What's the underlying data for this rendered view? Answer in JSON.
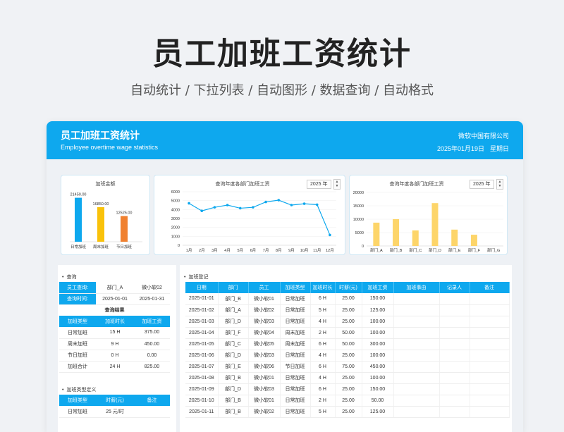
{
  "hero": {
    "title": "员工加班工资统计",
    "subtitle": "自动统计 / 下拉列表 / 自动图形 / 数据查询 / 自动格式"
  },
  "header": {
    "title": "员工加班工资统计",
    "subtitle": "Employee overtime wage statistics",
    "company": "微软中国有限公司",
    "date": "2025年01月19日",
    "weekday": "星期日"
  },
  "colors": {
    "accent": "#0ea8ee",
    "bar_weekday": "#0ea8ee",
    "bar_weekend": "#f9c20a",
    "bar_holiday": "#f0802f",
    "dept_bar": "#fdd56a"
  },
  "chart_data": [
    {
      "type": "bar",
      "title": "加班金额",
      "categories": [
        "日常加班",
        "周末加班",
        "节日加班"
      ],
      "values": [
        21450.0,
        16850.0,
        12525.0
      ],
      "data_labels": [
        "21450.00",
        "16850.00",
        "12525.00"
      ]
    },
    {
      "type": "line",
      "title": "查询年度各部门加班工资",
      "year": "2025 年",
      "categories": [
        "1月",
        "2月",
        "3月",
        "4月",
        "5月",
        "6月",
        "7月",
        "8月",
        "9月",
        "10月",
        "11月",
        "12月"
      ],
      "values": [
        4700,
        3850,
        4250,
        4500,
        4150,
        4250,
        4850,
        5050,
        4500,
        4650,
        4550,
        1150
      ],
      "ylim": [
        0,
        6000
      ],
      "yticks": [
        0,
        1000,
        2000,
        3000,
        4000,
        5000,
        6000
      ]
    },
    {
      "type": "bar",
      "title": "查询年度各部门加班工资",
      "year": "2025 年",
      "categories": [
        "部门_A",
        "部门_B",
        "部门_C",
        "部门_D",
        "部门_E",
        "部门_F",
        "部门_G"
      ],
      "values": [
        8700,
        10000,
        5800,
        16000,
        6100,
        4200,
        0
      ],
      "ylim": [
        0,
        20000
      ],
      "yticks": [
        0,
        5000,
        10000,
        15000,
        20000
      ]
    }
  ],
  "query": {
    "section": "查询",
    "employee_label": "员工查询:",
    "dept": "部门_A",
    "employee": "微小软02",
    "time_label": "查询时间:",
    "date_from": "2025-01-01",
    "date_to": "2025-01-31",
    "result_title": "查询结果",
    "headers": [
      "加班类型",
      "加班时长",
      "加班工资"
    ],
    "rows": [
      [
        "日常加班",
        "15 H",
        "375.00"
      ],
      [
        "周末加班",
        "9 H",
        "450.00"
      ],
      [
        "节日加班",
        "0 H",
        "0.00"
      ],
      [
        "加班合计",
        "24 H",
        "825.00"
      ]
    ]
  },
  "type_def": {
    "section": "加班类型定义",
    "headers": [
      "加班类型",
      "时薪(元)",
      "备注"
    ],
    "rows": [
      [
        "日常加班",
        "25 元/时",
        ""
      ]
    ]
  },
  "log": {
    "section": "加班登记",
    "headers": [
      "日期",
      "部门",
      "员工",
      "加班类型",
      "加班时长",
      "时薪(元)",
      "加班工资",
      "加班事由",
      "记录人",
      "备注"
    ],
    "rows": [
      [
        "2025-01-01",
        "部门_B",
        "微小软01",
        "日常加班",
        "6 H",
        "25.00",
        "150.00",
        "",
        "",
        ""
      ],
      [
        "2025-01-02",
        "部门_A",
        "微小软02",
        "日常加班",
        "5 H",
        "25.00",
        "125.00",
        "",
        "",
        ""
      ],
      [
        "2025-01-03",
        "部门_D",
        "微小软03",
        "日常加班",
        "4 H",
        "25.00",
        "100.00",
        "",
        "",
        ""
      ],
      [
        "2025-01-04",
        "部门_F",
        "微小软04",
        "周末加班",
        "2 H",
        "50.00",
        "100.00",
        "",
        "",
        ""
      ],
      [
        "2025-01-05",
        "部门_C",
        "微小软05",
        "周末加班",
        "6 H",
        "50.00",
        "300.00",
        "",
        "",
        ""
      ],
      [
        "2025-01-06",
        "部门_D",
        "微小软03",
        "日常加班",
        "4 H",
        "25.00",
        "100.00",
        "",
        "",
        ""
      ],
      [
        "2025-01-07",
        "部门_E",
        "微小软06",
        "节日加班",
        "6 H",
        "75.00",
        "450.00",
        "",
        "",
        ""
      ],
      [
        "2025-01-08",
        "部门_B",
        "微小软01",
        "日常加班",
        "4 H",
        "25.00",
        "100.00",
        "",
        "",
        ""
      ],
      [
        "2025-01-09",
        "部门_D",
        "微小软03",
        "日常加班",
        "6 H",
        "25.00",
        "150.00",
        "",
        "",
        ""
      ],
      [
        "2025-01-10",
        "部门_B",
        "微小软01",
        "日常加班",
        "2 H",
        "25.00",
        "50.00",
        "",
        "",
        ""
      ],
      [
        "2025-01-11",
        "部门_B",
        "微小软02",
        "日常加班",
        "5 H",
        "25.00",
        "125.00",
        "",
        "",
        ""
      ]
    ]
  }
}
